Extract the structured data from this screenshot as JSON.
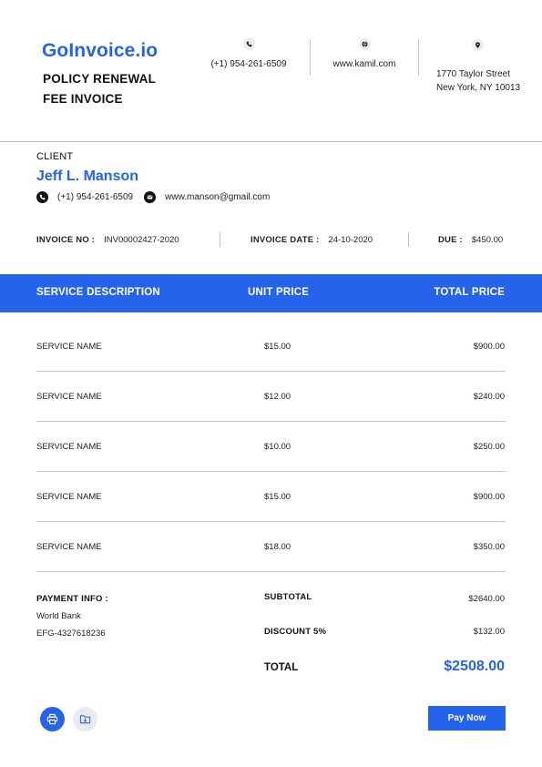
{
  "brand": {
    "name": "GoInvoice.io",
    "title_line1": "POLICY RENEWAL",
    "title_line2": "FEE INVOICE"
  },
  "company": {
    "phone": "(+1) 954-261-6509",
    "website": "www.kamil.com",
    "address_line1": "1770 Taylor Street",
    "address_line2": "New York, NY 10013"
  },
  "client": {
    "label": "CLIENT",
    "name": "Jeff L. Manson",
    "phone": "(+1) 954-261-6509",
    "email": "www.manson@gmail.com"
  },
  "meta": {
    "invoice_no_label": "INVOICE NO :",
    "invoice_no": "INV00002427-2020",
    "invoice_date_label": "INVOICE DATE :",
    "invoice_date": "24-10-2020",
    "due_label": "DUE :",
    "due": "$450.00"
  },
  "table": {
    "headers": [
      "SERVICE DESCRIPTION",
      "UNIT PRICE",
      "TOTAL PRICE"
    ],
    "rows": [
      {
        "service": "SERVICE NAME",
        "unit": "$15.00",
        "total": "$900.00"
      },
      {
        "service": "SERVICE NAME",
        "unit": "$12.00",
        "total": "$240.00"
      },
      {
        "service": "SERVICE NAME",
        "unit": "$10.00",
        "total": "$250.00"
      },
      {
        "service": "SERVICE NAME",
        "unit": "$15.00",
        "total": "$900.00"
      },
      {
        "service": "SERVICE NAME",
        "unit": "$18.00",
        "total": "$350.00"
      }
    ]
  },
  "payment": {
    "label": "PAYMENT INFO :",
    "bank": "World Bank",
    "account": "EFG-4327618236"
  },
  "summary": {
    "subtotal_label": "SUBTOTAL",
    "subtotal": "$2640.00",
    "discount_label": "DISCOUNT 5%",
    "discount": "$132.00",
    "total_label": "TOTAL",
    "total": "$2508.00"
  },
  "actions": {
    "pay_now": "Pay Now"
  },
  "icons": {
    "phone": "phone-icon",
    "web": "globe-icon",
    "location": "location-pin-icon",
    "email": "mail-icon",
    "print": "printer-icon",
    "save": "folder-download-icon"
  },
  "colors": {
    "accent": "#2563eb"
  }
}
